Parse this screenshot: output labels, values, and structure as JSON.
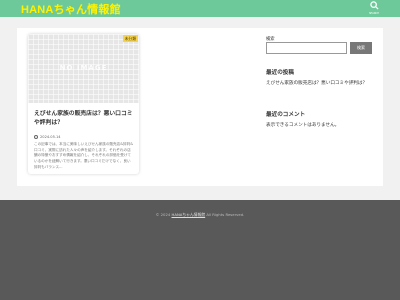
{
  "header": {
    "site_title": "HANAちゃん情報館",
    "search_label": "SEARCH"
  },
  "post": {
    "category": "未分類",
    "thumbnail_text": "NO IMAGE",
    "title": "えびせん家族の販売店は？悪い口コミや評判は？",
    "date": "2024.05.14",
    "excerpt": "この記事では、本当に美味しいえびせん家族の販売店&評判&口コミ、実際に訪れた人々の声を紹介します。それぞれの店舗の特徴やおすすめ情報を紹介し、それぞれの評価を受けているのかを紐解いて行きます。悪い口コミだけでなく、良い評判もバランス..."
  },
  "sidebar": {
    "search": {
      "label": "検索",
      "button": "検索",
      "placeholder": ""
    },
    "recent_posts": {
      "title": "最近の投稿",
      "items": [
        "えびせん家族の販売店は？悪い口コミや評判は？"
      ]
    },
    "recent_comments": {
      "title": "最近のコメント",
      "empty_text": "表示できるコメントはありません。"
    }
  },
  "footer": {
    "prefix": "© 2024",
    "site": "HANAちゃん情報館",
    "suffix": "All Rights Reserved."
  },
  "colors": {
    "header_bg": "#6ec99a",
    "title": "#fff200",
    "footer_bg": "#595959"
  }
}
